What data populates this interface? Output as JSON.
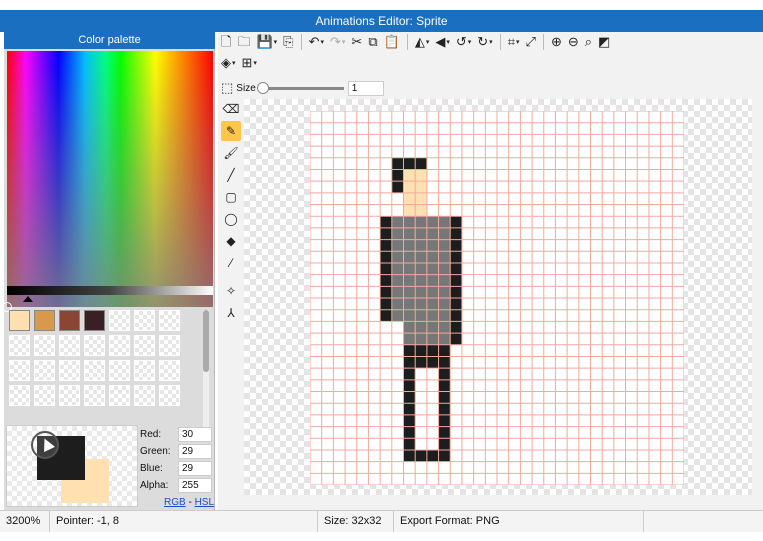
{
  "window": {
    "title": "Animations Editor: Sprite"
  },
  "palette": {
    "title": "Color palette",
    "swatches": [
      "#ffe0b0",
      "#d9994a",
      "#8a4535",
      "#3a2024",
      "",
      "",
      "",
      "",
      "",
      "",
      "",
      "",
      "",
      "",
      "",
      "",
      "",
      "",
      "",
      "",
      "",
      "",
      "",
      "",
      "",
      "",
      "",
      ""
    ],
    "foreground_color": "#1e1d1d",
    "background_color": "#ffe0b0",
    "red_label": "Red:",
    "red": "30",
    "green_label": "Green:",
    "green": "29",
    "blue_label": "Blue:",
    "blue": "29",
    "alpha_label": "Alpha:",
    "alpha": "255",
    "rgb_link": "RGB",
    "mode_sep": "-",
    "hsl_link": "HSL"
  },
  "toolbar": {
    "size_label": "Size",
    "size_value": "1",
    "row1": [
      "new-file-icon",
      "open-folder-icon",
      "save-icon",
      "export-icon",
      "undo-icon",
      "redo-icon",
      "cut-icon",
      "copy-icon",
      "paste-icon",
      "flip-horizontal-icon",
      "flip-vertical-icon",
      "rotate-left-icon",
      "rotate-right-icon",
      "crop-icon",
      "resize-icon",
      "zoom-in-icon",
      "zoom-out-icon",
      "zoom-fit-icon",
      "fill-screen-icon"
    ],
    "row2": [
      "layers-icon",
      "grid-icon"
    ]
  },
  "tools": [
    "eraser-icon",
    "pencil-icon",
    "brush-icon",
    "line-icon",
    "rectangle-icon",
    "ellipse-icon",
    "bucket-fill-icon",
    "eyedropper-icon",
    "move-icon",
    "nodes-icon"
  ],
  "active_tool": "pencil-icon",
  "canvas": {
    "grid_color": "#f3a9a0",
    "colors": {
      "H": "#1e1d1d",
      "S": "#ffe0b0",
      "G": "#777777",
      "P": "#1e1d1d"
    },
    "rows": [
      "................................",
      "................................",
      "................................",
      "................................",
      ".......HHH......................",
      ".......HSS......................",
      ".......HSS......................",
      "........SS......................",
      "........SS......................",
      "......HGGGGGH...................",
      "......HGGGGGH...................",
      "......HGGGGGH...................",
      "......HGGGGGH...................",
      "......HGGGGGH...................",
      "......HGGGGGH...................",
      "......HGGGGGH...................",
      "......HGGGGGH...................",
      "......HGGGGGH...................",
      "........GGGGH...................",
      "........GGGGH...................",
      "........PPPP....................",
      "........PPPP....................",
      "........P..P....................",
      "........P..P....................",
      "........P..P....................",
      "........P..P....................",
      "........P..P....................",
      "........P..P....................",
      "........P..P....................",
      "........PPPP....................",
      "................................",
      "................................"
    ]
  },
  "status": {
    "zoom": "3200%",
    "pointer": "Pointer: -1, 8",
    "size": "Size: 32x32",
    "export_format": "Export Format: PNG"
  }
}
